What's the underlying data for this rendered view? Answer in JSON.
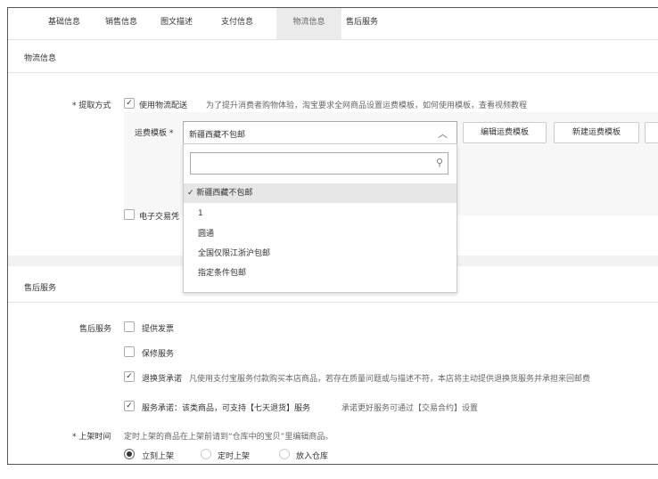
{
  "tabs": [
    "基础信息",
    "销售信息",
    "图文描述",
    "支付信息",
    "物流信息",
    "售后服务"
  ],
  "active_tab": "物流信息",
  "logistics": {
    "section_title": "物流信息",
    "pickup_label": "* 提取方式",
    "use_logistics_label": "使用物流配送",
    "use_logistics_checked": true,
    "pickup_note": "为了提升消费者购物体验，淘宝要求全网商品设置运费模板，如何使用模板，查看视频教程",
    "template_label": "运费模板 *",
    "template_value": "新疆西藏不包邮",
    "edit_button": "编辑运费模板",
    "new_button": "新建运费模板",
    "e_voucher_label": "电子交易凭",
    "search_placeholder": "",
    "options": [
      "新疆西藏不包邮",
      "1",
      "圆通",
      "全国仅限江浙沪包邮",
      "指定条件包邮"
    ],
    "selected_option": "新疆西藏不包邮"
  },
  "after_sales": {
    "section_title": "售后服务",
    "row_label": "售后服务",
    "invoice": "提供发票",
    "warranty": "保修服务",
    "return_label": "退换货承诺",
    "return_note": "凡使用支付宝服务付款购买本店商品，若存在质量问题或与描述不符，本店将主动提供退换货服务并承担来回邮费",
    "service_label": "服务承诺：该类商品，可支持【七天退货】服务",
    "service_note": "承诺更好服务可通过【交易合约】设置",
    "listing_label": "* 上架时间",
    "listing_note": "定时上架的商品在上架前请到“仓库中的宝贝”里编辑商品。",
    "radios": [
      "立刻上架",
      "定时上架",
      "放入仓库"
    ],
    "selected_radio": "立刻上架"
  }
}
